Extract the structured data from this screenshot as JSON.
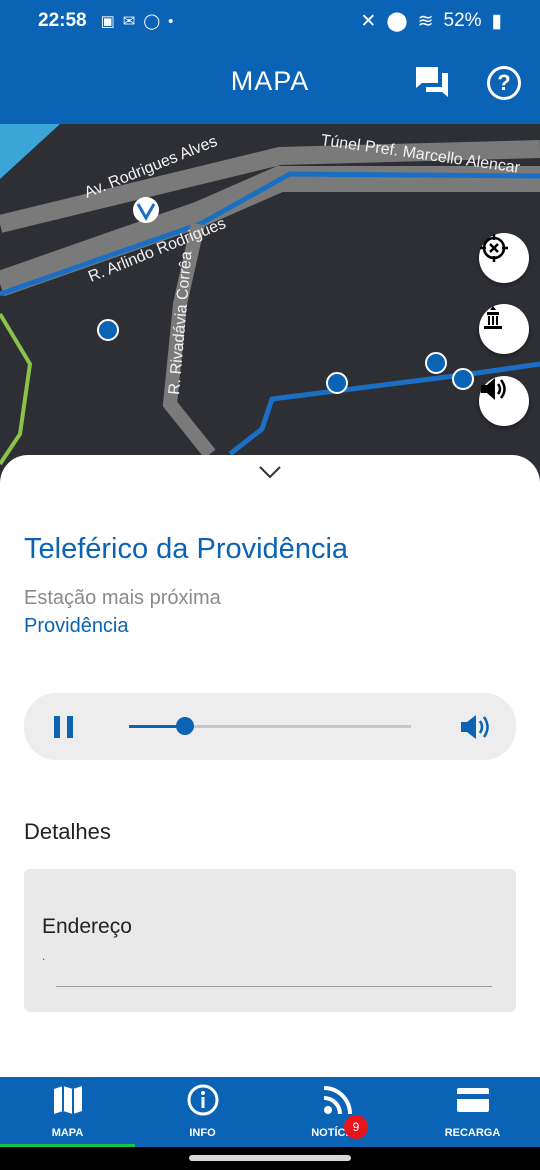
{
  "status_bar": {
    "time": "22:58",
    "battery": "52%"
  },
  "header": {
    "title": "MAPA"
  },
  "map": {
    "streets": [
      "Av. Rodrigues Alves",
      "Túnel Pref. Marcello Alencar",
      "R. Arlindo Rodrigues",
      "R. Rivadávia Corrêa"
    ]
  },
  "sheet": {
    "place_title": "Teleférico da Providência",
    "nearest_label": "Estação mais próxima",
    "nearest_value": "Providência",
    "audio_progress": 0.2,
    "details_title": "Detalhes",
    "address_label": "Endereço",
    "address_value": "."
  },
  "nav": {
    "items": [
      {
        "label": "MAPA",
        "active": true
      },
      {
        "label": "INFO"
      },
      {
        "label": "NOTÍCIAS",
        "badge": "9"
      },
      {
        "label": "RECARGA"
      }
    ]
  },
  "colors": {
    "primary": "#0b63b5",
    "active_indicator": "#19c24a",
    "badge": "#e8141b"
  }
}
